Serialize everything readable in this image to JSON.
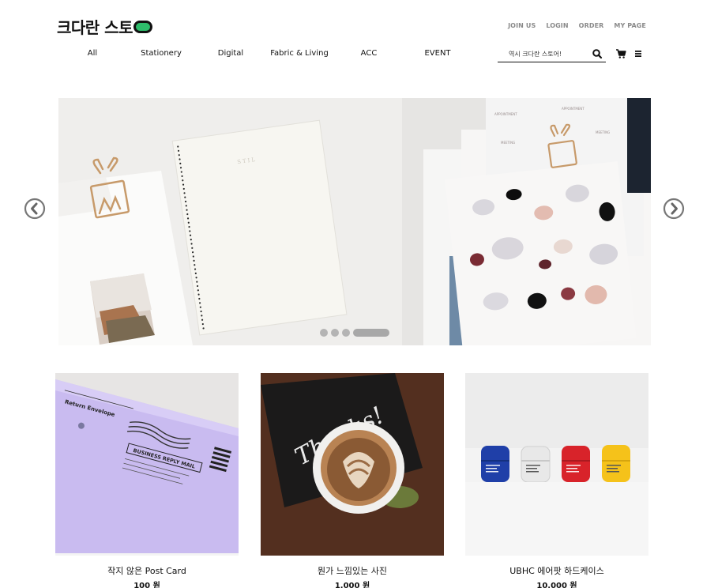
{
  "header": {
    "logo_text": "크다란 스토",
    "top_links": [
      "JOIN US",
      "LOGIN",
      "ORDER",
      "MY PAGE"
    ],
    "nav": [
      "All",
      "Stationery",
      "Digital",
      "Fabric & Living",
      "ACC",
      "EVENT"
    ],
    "search_placeholder": "역시 크다란 스토어!"
  },
  "hero": {
    "slide_count": 4,
    "active_slide": 4,
    "stamp_text": "STIL",
    "card_words": [
      "APPOINTMENT",
      "MEETING",
      "APPOINTMENT",
      "MEETING"
    ]
  },
  "products": [
    {
      "name": "작지 않은 Post Card",
      "price": "100 원",
      "image": "lavender-envelope",
      "envelope_text": "Return Envelope",
      "reply_label": "BUSINESS REPLY MAIL"
    },
    {
      "name": "뭔가 느낌있는 사진",
      "price": "1,000 원",
      "image": "coffee-thanks-card",
      "card_text": "Thanks!"
    },
    {
      "name": "UBHC 에어팟 하드케이스",
      "price": "10,000 원",
      "image": "airpods-cases"
    }
  ],
  "colors": {
    "logo_accent": "#2ebd6b",
    "envelope": "#c8b8f0",
    "case_blue": "#1f3fa8",
    "case_red": "#d8232a",
    "case_yellow": "#f5c21a"
  }
}
